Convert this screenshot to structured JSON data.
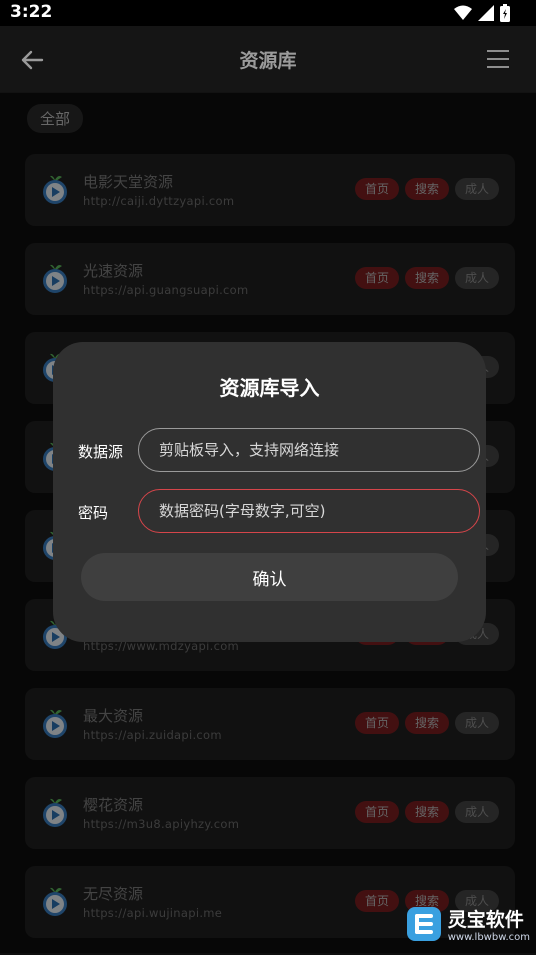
{
  "status": {
    "time": "3:22"
  },
  "header": {
    "title": "资源库"
  },
  "filter": {
    "chip": "全部"
  },
  "sources": [
    {
      "name": "电影天堂资源",
      "url": "http://caiji.dyttzyapi.com"
    },
    {
      "name": "光速资源",
      "url": "https://api.guangsuapi.com"
    },
    {
      "name": "",
      "url": ""
    },
    {
      "name": "",
      "url": ""
    },
    {
      "name": "",
      "url": ""
    },
    {
      "name": "",
      "url": "https://www.mdzyapi.com"
    },
    {
      "name": "最大资源",
      "url": "https://api.zuidapi.com"
    },
    {
      "name": "樱花资源",
      "url": "https://m3u8.apiyhzy.com"
    },
    {
      "name": "无尽资源",
      "url": "https://api.wujinapi.me"
    }
  ],
  "tags": {
    "home": "首页",
    "search": "搜索",
    "adult": "成人"
  },
  "dialog": {
    "title": "资源库导入",
    "source_label": "数据源",
    "source_placeholder": "剪贴板导入，支持网络连接",
    "password_label": "密码",
    "password_placeholder": "数据密码(字母数字,可空)",
    "confirm": "确认"
  },
  "watermark": {
    "name": "灵宝软件",
    "url": "www.lbwbw.com"
  },
  "colors": {
    "accent_red": "#7a1e20",
    "error_border": "#d6454a",
    "dialog_bg": "#303030"
  }
}
